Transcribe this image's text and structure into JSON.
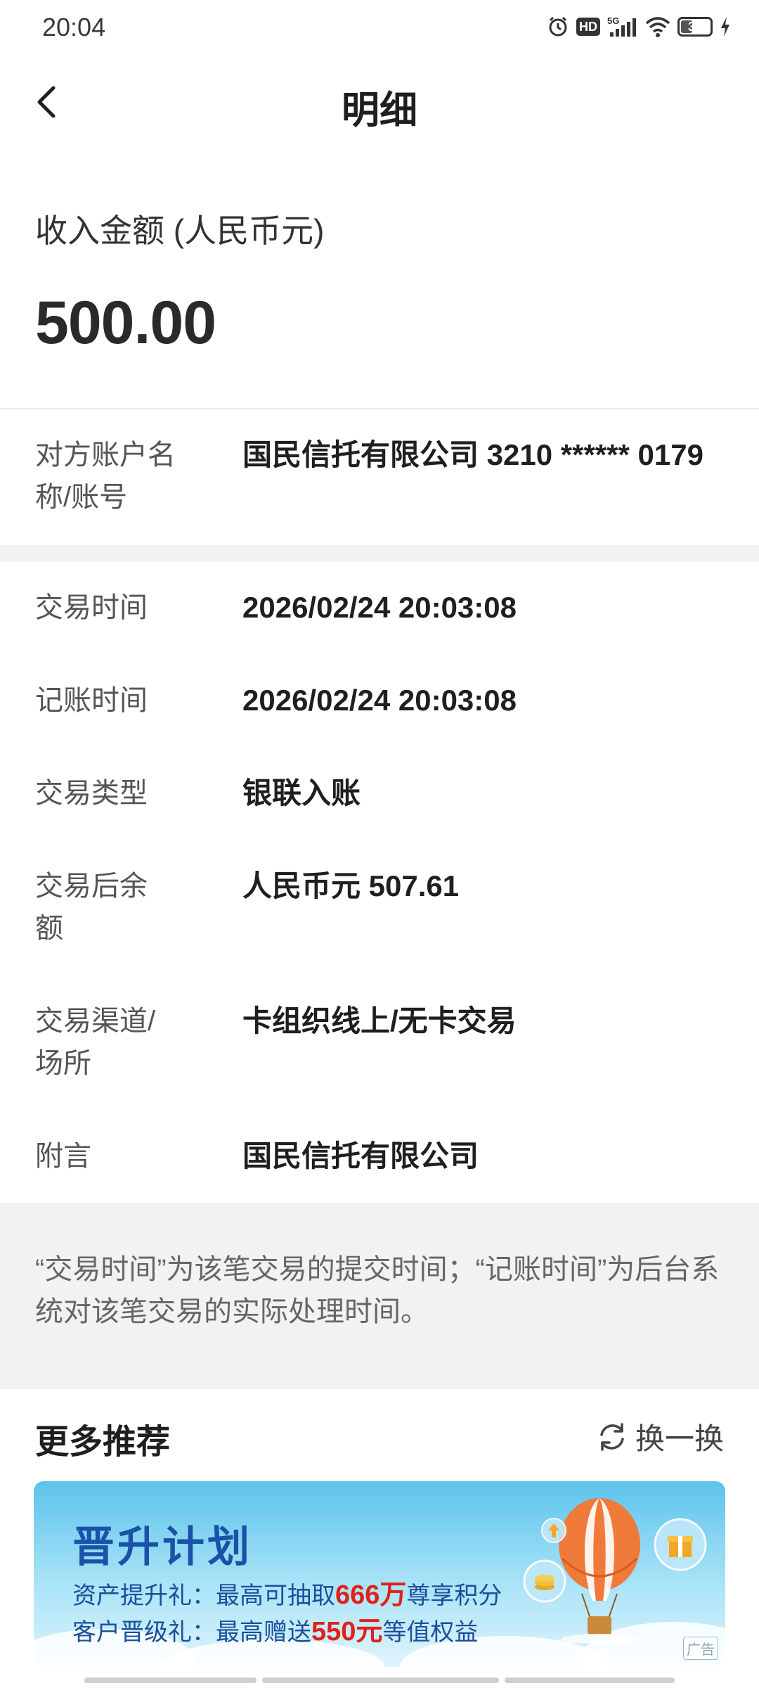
{
  "status_bar": {
    "time": "20:04",
    "icons": [
      "alarm-icon",
      "hd-icon",
      "signal-5g-icon",
      "wifi-icon",
      "battery-icon",
      "charging-icon"
    ],
    "network": "5G",
    "hd_label": "HD",
    "battery_level": "37"
  },
  "header": {
    "title": "明细",
    "back_icon": "chevron-left-icon"
  },
  "amount": {
    "label": "收入金额 (人民币元)",
    "value": "500.00"
  },
  "counterparty": {
    "label": "对方账户名称/账号",
    "value": "国民信托有限公司 3210 ****** 0179"
  },
  "details": [
    {
      "label": "交易时间",
      "value": "2026/02/24 20:03:08"
    },
    {
      "label": "记账时间",
      "value": "2026/02/24 20:03:08"
    },
    {
      "label": "交易类型",
      "value": "银联入账"
    },
    {
      "label": "交易后余额",
      "value": "人民币元 507.61"
    },
    {
      "label": "交易渠道/场所",
      "value": "卡组织线上/无卡交易"
    },
    {
      "label": "附言",
      "value": "国民信托有限公司"
    }
  ],
  "note": "“交易时间”为该笔交易的提交时间；“记账时间”为后台系统对该笔交易的实际处理时间。",
  "recommend": {
    "title": "更多推荐",
    "refresh_label": "换一换",
    "refresh_icon": "refresh-icon"
  },
  "banner": {
    "title": "晋升计划",
    "line1_prefix": "资产提升礼：最高可抽取",
    "line1_highlight": "666万",
    "line1_suffix": "尊享积分",
    "line2_prefix": "客户晋级礼：最高赠送",
    "line2_highlight": "550元",
    "line2_suffix": "等值权益",
    "ad_label": "广告",
    "colors": {
      "title": "#1a52a8",
      "highlight": "#e0201b"
    }
  }
}
